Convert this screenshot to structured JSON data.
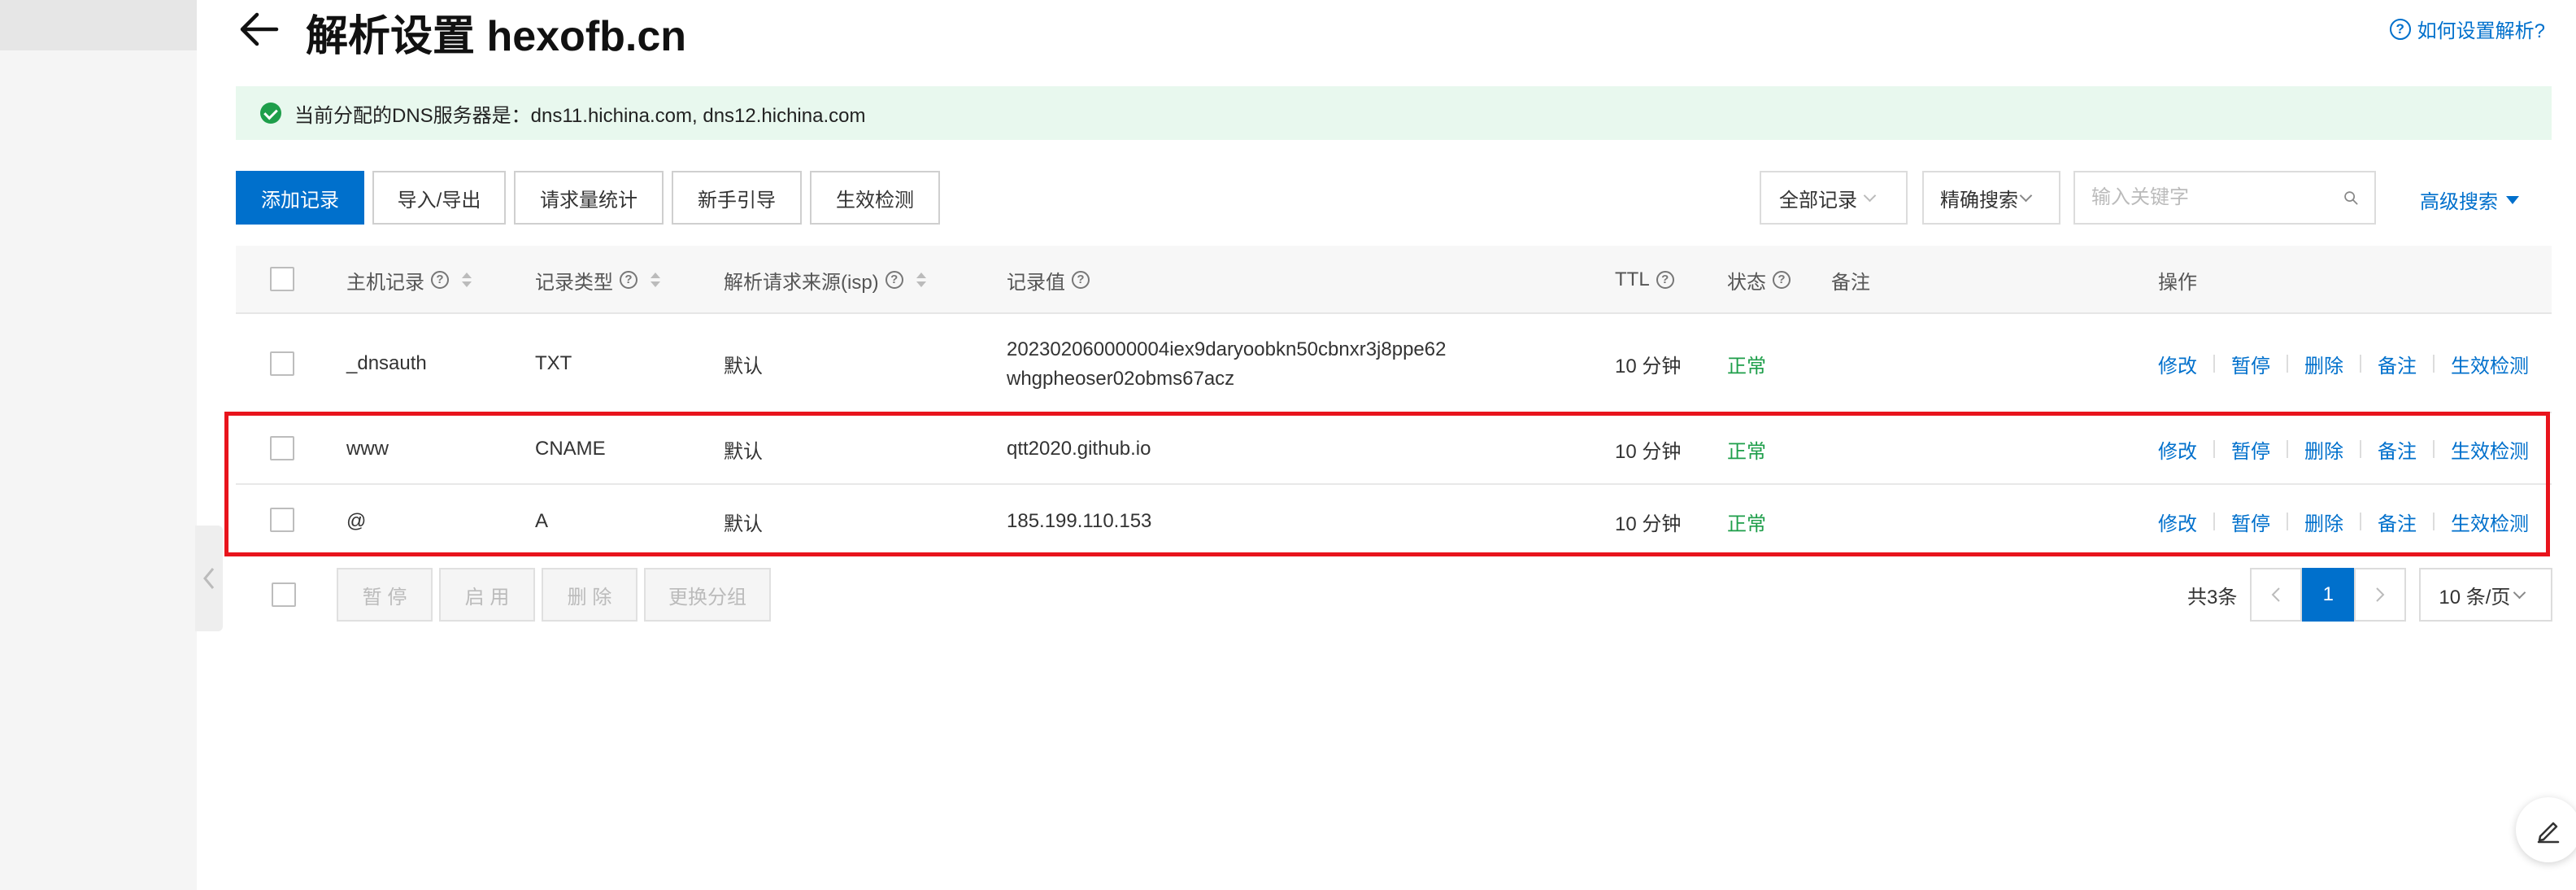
{
  "header": {
    "title": "解析设置 hexofb.cn",
    "help_link": "如何设置解析?"
  },
  "notice": {
    "text": "当前分配的DNS服务器是：dns11.hichina.com, dns12.hichina.com"
  },
  "toolbar": {
    "buttons": [
      "添加记录",
      "导入/导出",
      "请求量统计",
      "新手引导",
      "生效检测"
    ],
    "record_filter": "全部记录",
    "search_mode": "精确搜索",
    "search_placeholder": "输入关键字",
    "advanced_search": "高级搜索"
  },
  "table": {
    "columns": [
      "主机记录",
      "记录类型",
      "解析请求来源(isp)",
      "记录值",
      "TTL",
      "状态",
      "备注",
      "操作"
    ],
    "rows": [
      {
        "host": "_dnsauth",
        "type": "TXT",
        "isp": "默认",
        "value_line1": "202302060000004iex9daryoobkn50cbnxr3j8ppe62",
        "value_line2": "whgpheoser02obms67acz",
        "ttl": "10 分钟",
        "status": "正常",
        "remark": ""
      },
      {
        "host": "www",
        "type": "CNAME",
        "isp": "默认",
        "value_line1": "qtt2020.github.io",
        "value_line2": "",
        "ttl": "10 分钟",
        "status": "正常",
        "remark": ""
      },
      {
        "host": "@",
        "type": "A",
        "isp": "默认",
        "value_line1": "185.199.110.153",
        "value_line2": "",
        "ttl": "10 分钟",
        "status": "正常",
        "remark": ""
      }
    ],
    "row_actions": [
      "修改",
      "暂停",
      "删除",
      "备注",
      "生效检测"
    ]
  },
  "bulk_actions": [
    "暂 停",
    "启 用",
    "删 除",
    "更换分组"
  ],
  "pagination": {
    "total": "共3条",
    "current_page": "1",
    "page_size": "10 条/页"
  },
  "colors": {
    "primary": "#0070cc",
    "success": "#1e9e4a",
    "highlight": "#e8141c",
    "notice_bg": "#e8f8ee"
  }
}
